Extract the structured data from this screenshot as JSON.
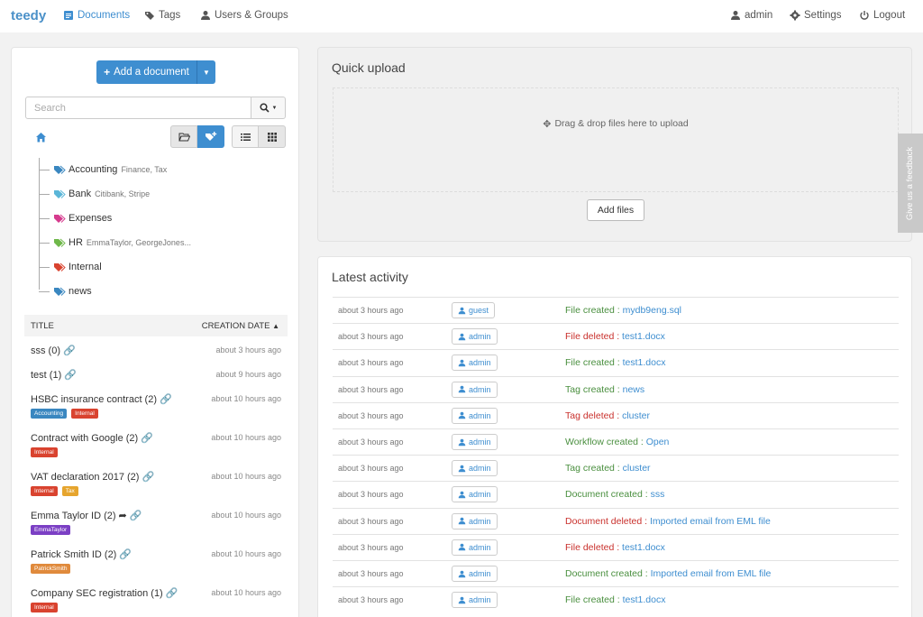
{
  "nav": {
    "brand": "teedy",
    "documents": "Documents",
    "tags": "Tags",
    "users_groups": "Users & Groups",
    "admin": "admin",
    "settings": "Settings",
    "logout": "Logout"
  },
  "colors": {
    "primary": "#3e8ed0",
    "success_text": "#4a8f3f",
    "danger_text": "#c9302c"
  },
  "sidebar": {
    "add_document": "Add a document",
    "search_placeholder": "Search",
    "tags": [
      {
        "name": "Accounting",
        "sub": "Finance, Tax",
        "color": "#3a87c0"
      },
      {
        "name": "Bank",
        "sub": "Citibank, Stripe",
        "color": "#5bb6d8"
      },
      {
        "name": "Expenses",
        "sub": "",
        "color": "#d63b8e"
      },
      {
        "name": "HR",
        "sub": "EmmaTaylor, GeorgeJones...",
        "color": "#6fb84a"
      },
      {
        "name": "Internal",
        "sub": "",
        "color": "#d9432f"
      },
      {
        "name": "news",
        "sub": "",
        "color": "#3a87c0"
      }
    ],
    "table_header": {
      "title": "TITLE",
      "creation_date": "CREATION DATE"
    },
    "documents": [
      {
        "title": "sss (0)",
        "date": "about 3 hours ago",
        "share": false,
        "tags": []
      },
      {
        "title": "test (1)",
        "date": "about 9 hours ago",
        "share": false,
        "tags": []
      },
      {
        "title": "HSBC insurance contract (2)",
        "date": "about 10 hours ago",
        "share": false,
        "tags": [
          {
            "label": "Accounting",
            "color": "#3a87c0"
          },
          {
            "label": "Internal",
            "color": "#d9432f"
          }
        ]
      },
      {
        "title": "Contract with Google (2)",
        "date": "about 10 hours ago",
        "share": false,
        "tags": [
          {
            "label": "Internal",
            "color": "#d9432f"
          }
        ]
      },
      {
        "title": "VAT declaration 2017 (2)",
        "date": "about 10 hours ago",
        "share": false,
        "tags": [
          {
            "label": "Internal",
            "color": "#d9432f"
          },
          {
            "label": "Tax",
            "color": "#e6a52e"
          }
        ]
      },
      {
        "title": "Emma Taylor ID (2)",
        "date": "about 10 hours ago",
        "share": true,
        "tags": [
          {
            "label": "EmmaTaylor",
            "color": "#7b3fc4"
          }
        ]
      },
      {
        "title": "Patrick Smith ID (2)",
        "date": "about 10 hours ago",
        "share": false,
        "tags": [
          {
            "label": "PatrickSmith",
            "color": "#e08a3c"
          }
        ]
      },
      {
        "title": "Company SEC registration (1)",
        "date": "about 10 hours ago",
        "share": false,
        "tags": [
          {
            "label": "Internal",
            "color": "#d9432f"
          }
        ]
      }
    ]
  },
  "upload": {
    "title": "Quick upload",
    "drop_text": "Drag & drop files here to upload",
    "add_files": "Add files"
  },
  "feedback": "Give us a feedback",
  "activity": {
    "title": "Latest activity",
    "rows": [
      {
        "time": "about 3 hours ago",
        "user": "guest",
        "action": "File created :",
        "target": "mydb9eng.sql",
        "type": "create"
      },
      {
        "time": "about 3 hours ago",
        "user": "admin",
        "action": "File deleted :",
        "target": "test1.docx",
        "type": "delete"
      },
      {
        "time": "about 3 hours ago",
        "user": "admin",
        "action": "File created :",
        "target": "test1.docx",
        "type": "create"
      },
      {
        "time": "about 3 hours ago",
        "user": "admin",
        "action": "Tag created :",
        "target": "news",
        "type": "create"
      },
      {
        "time": "about 3 hours ago",
        "user": "admin",
        "action": "Tag deleted :",
        "target": "cluster",
        "type": "delete"
      },
      {
        "time": "about 3 hours ago",
        "user": "admin",
        "action": "Workflow created :",
        "target": "Open",
        "type": "create"
      },
      {
        "time": "about 3 hours ago",
        "user": "admin",
        "action": "Tag created :",
        "target": "cluster",
        "type": "create"
      },
      {
        "time": "about 3 hours ago",
        "user": "admin",
        "action": "Document created :",
        "target": "sss",
        "type": "create"
      },
      {
        "time": "about 3 hours ago",
        "user": "admin",
        "action": "Document deleted :",
        "target": "Imported email from EML file",
        "type": "delete"
      },
      {
        "time": "about 3 hours ago",
        "user": "admin",
        "action": "File deleted :",
        "target": "test1.docx",
        "type": "delete"
      },
      {
        "time": "about 3 hours ago",
        "user": "admin",
        "action": "Document created :",
        "target": "Imported email from EML file",
        "type": "create"
      },
      {
        "time": "about 3 hours ago",
        "user": "admin",
        "action": "File created :",
        "target": "test1.docx",
        "type": "create"
      }
    ]
  }
}
